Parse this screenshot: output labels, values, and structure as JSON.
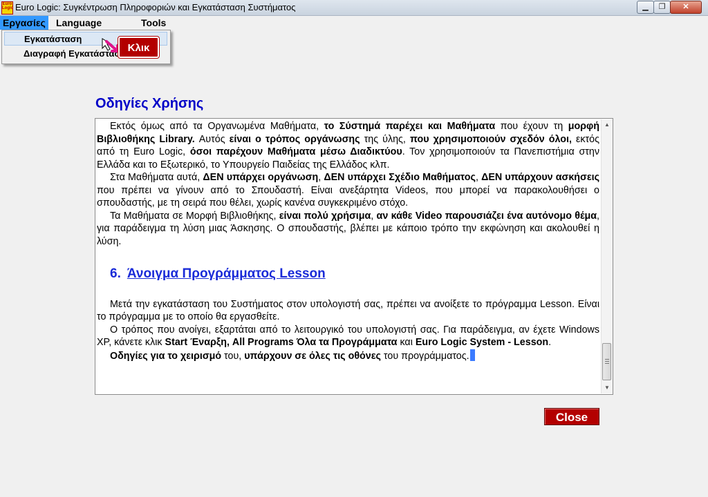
{
  "window": {
    "title": "Euro Logic: Συγκέντρωση Πληροφοριών και Εγκατάσταση Συστήματος",
    "icon_text": "Euro Logic",
    "min_glyph": "▁",
    "max_glyph": "❐",
    "close_glyph": "✕"
  },
  "menubar": {
    "items": [
      "Εργασίες",
      "Language",
      "Tools"
    ]
  },
  "dropdown": {
    "items": [
      "Εγκατάσταση",
      "Διαγραφή Εγκατάστασης"
    ]
  },
  "annotation": {
    "click_label": "Κλικ"
  },
  "heading": "Οδηγίες Χρήσης",
  "content": {
    "p1": [
      "Εκτός όμως από τα Οργανωμένα Μαθήματα, ",
      "το Σύστημά παρέχει και Μαθήματα",
      " που έχουν τη ",
      "μορφή Βιβλιοθήκης  Library.",
      "  Αυτός ",
      "είναι ο τρόπος οργάνωσης",
      " της ύλης, ",
      "που χρησιμοποιούν σχεδόν όλοι,",
      " εκτός από τη Euro Logic, ",
      "όσοι  παρέχουν Μαθήματα μέσω Διαδικτύου",
      ".  Τον χρησιμοποιούν τα Πανεπιστήμια στην Ελλάδα και το Εξωτερικό, το Υπουργείο Παιδείας της Ελλάδος κλπ."
    ],
    "p2": [
      "Στα Μαθήματα αυτά, ",
      "ΔΕΝ υπάρχει οργάνωση",
      ", ",
      "ΔΕΝ υπάρχει Σχέδιο Μαθήματος",
      ", ",
      "ΔΕΝ υπάρχουν ασκήσεις",
      " που πρέπει να γίνουν από το Σπουδαστή.  Είναι ανεξάρτητα Videos, που μπορεί να παρακολουθήσει ο σπουδαστής, με τη σειρά που θέλει, χωρίς κανένα συγκεκριμένο στόχο."
    ],
    "p3": [
      "Τα Μαθήματα σε Μορφή Βιβλιοθήκης, ",
      "είναι πολύ χρήσιμα",
      ", ",
      "αν κάθε Video παρουσιάζει ένα αυτόνομο θέμα",
      ", για παράδειγμα τη λύση μιας Άσκησης.  Ο σπουδαστής, βλέπει με κάποιο τρόπο την εκφώνηση και ακολουθεί η λύση."
    ],
    "section": {
      "number": "6.",
      "title": "Άνοιγμα Προγράμματος Lesson"
    },
    "p4": "Μετά την εγκατάσταση του Συστήματος στον υπολογιστή σας, πρέπει να ανοίξετε το πρόγραμμα Lesson.  Είναι το πρόγραμμα με το οποίο θα εργασθείτε.",
    "p5": [
      "Ο τρόπος που ανοίγει, εξαρτάται από το λειτουργικό του υπολογιστή σας.  Για παράδειγμα, αν έχετε Windows XP, κάνετε κλικ ",
      "Start Έναρξη, All Programs Όλα τα Προγράμματα",
      " και ",
      "Euro Logic System - Lesson",
      "."
    ],
    "p6": [
      "Οδηγίες για το χειρισμό",
      " του, ",
      "υπάρχουν σε όλες τις οθόνες",
      " του προγράμματος."
    ]
  },
  "scrollbar": {
    "up_glyph": "▲",
    "down_glyph": "▼"
  },
  "buttons": {
    "close_label": "Close"
  }
}
